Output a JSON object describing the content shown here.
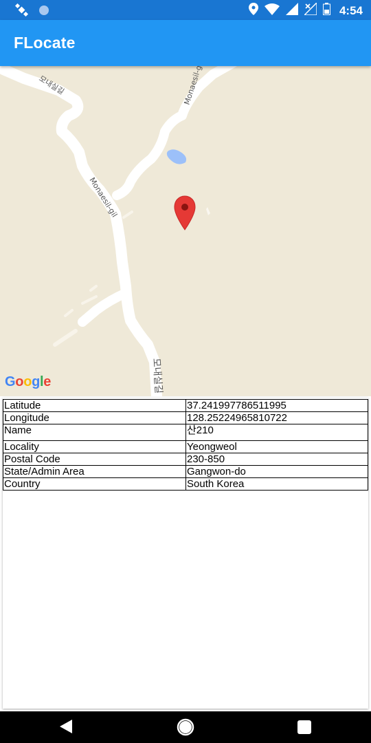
{
  "status_bar": {
    "time": "4:54",
    "icons": [
      "satellite-icon",
      "circle-indicator-icon",
      "location-icon",
      "wifi-icon",
      "cell-signal-icon",
      "no-signal-icon",
      "battery-icon"
    ]
  },
  "app_bar": {
    "title": "FLocate"
  },
  "map": {
    "road_labels": [
      "모내실길",
      "Monaesil-gil",
      "Monaesil-gil",
      "모내실길"
    ],
    "attribution": "Google",
    "colors": {
      "land": "#efe9d8",
      "road": "#ffffff",
      "water": "#9cc0f9",
      "marker": "#e53935"
    }
  },
  "info": {
    "rows": [
      {
        "label": "Latitude",
        "value": "37.241997786511995"
      },
      {
        "label": "Longitude",
        "value": "128.25224965810722"
      },
      {
        "label": "Name",
        "value": "산210"
      },
      {
        "label": "Locality",
        "value": "Yeongweol"
      },
      {
        "label": "Postal Code",
        "value": "230-850"
      },
      {
        "label": "State/Admin Area",
        "value": "Gangwon-do"
      },
      {
        "label": "Country",
        "value": "South Korea"
      }
    ]
  },
  "nav_bar": {
    "buttons": [
      "back-icon",
      "home-icon",
      "recents-icon"
    ]
  }
}
